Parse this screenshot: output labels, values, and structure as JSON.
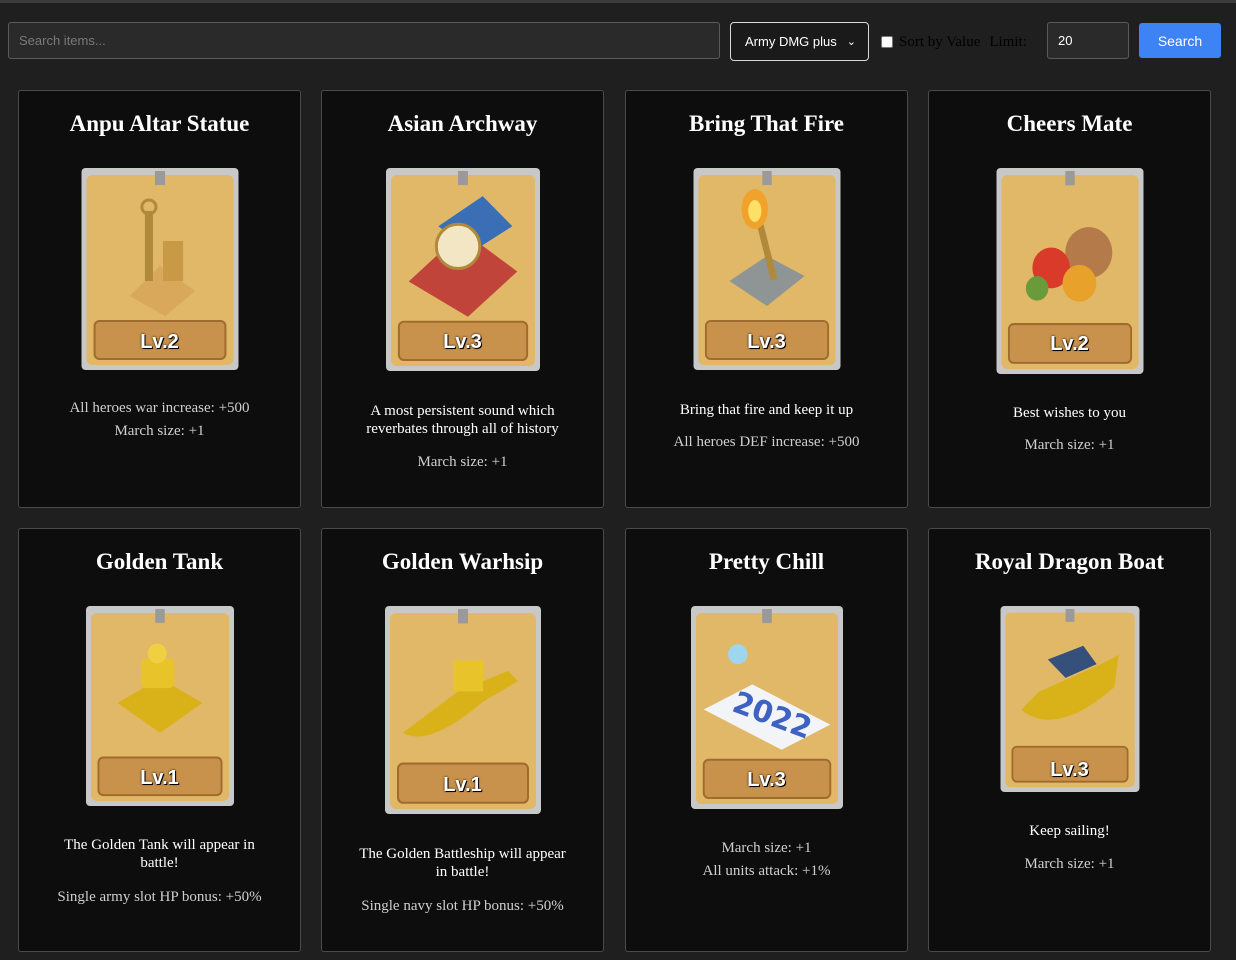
{
  "search": {
    "placeholder": "Search items..."
  },
  "filter": {
    "selected": "Army DMG plus"
  },
  "sort": {
    "label": "Sort by Value"
  },
  "limit": {
    "label": "Limit:",
    "value": "20"
  },
  "search_button": {
    "label": "Search"
  },
  "colors": {
    "accent": "#3d83f5",
    "card_bg": "#0d0d0d",
    "page_bg": "#1f1f1f",
    "badge_gold": "#c8914c"
  },
  "items": [
    {
      "title": "Anpu Altar Statue",
      "level": "Lv.2",
      "icon": "altar-statue-icon",
      "desc": "",
      "stats": [
        "All heroes war increase: +500",
        "March size: +1"
      ]
    },
    {
      "title": "Asian Archway",
      "level": "Lv.3",
      "icon": "archway-icon",
      "desc": "A most persistent sound which reverbates through all of history",
      "stats": [
        "March size: +1"
      ]
    },
    {
      "title": "Bring That Fire",
      "level": "Lv.3",
      "icon": "torch-icon",
      "desc": "Bring that fire and keep it up",
      "stats": [
        "All heroes DEF increase: +500"
      ]
    },
    {
      "title": "Cheers Mate",
      "level": "Lv.2",
      "icon": "feast-icon",
      "desc": "Best wishes to you",
      "stats": [
        "March size: +1"
      ]
    },
    {
      "title": "Golden Tank",
      "level": "Lv.1",
      "icon": "golden-tank-icon",
      "desc": "The Golden Tank will appear in battle!",
      "stats": [
        "Single army slot HP bonus: +50%"
      ]
    },
    {
      "title": "Golden Warhsip",
      "level": "Lv.1",
      "icon": "golden-warship-icon",
      "desc": "The Golden Battleship will appear in battle!",
      "stats": [
        "Single navy slot HP bonus: +50%"
      ]
    },
    {
      "title": "Pretty Chill",
      "level": "Lv.3",
      "icon": "snow-2022-icon",
      "desc": "",
      "stats": [
        "March size: +1",
        "All units attack: +1%"
      ]
    },
    {
      "title": "Royal Dragon Boat",
      "level": "Lv.3",
      "icon": "dragon-boat-icon",
      "desc": "Keep sailing!",
      "stats": [
        "March size: +1"
      ]
    }
  ]
}
